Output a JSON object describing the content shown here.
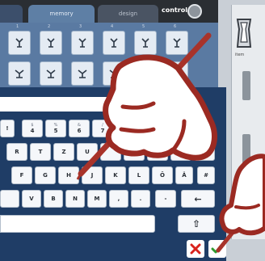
{
  "tabs": [
    {
      "label": ""
    },
    {
      "label": "memory"
    },
    {
      "label": "design"
    }
  ],
  "control_label": "control",
  "right_panel": {
    "caption": "item"
  },
  "row_numbers": [
    "1",
    "2",
    "3",
    "4",
    "5",
    "6"
  ],
  "keyboard": {
    "row1": [
      {
        "top": "",
        "main": "!"
      },
      {
        "top": "$",
        "main": "4"
      },
      {
        "top": "%",
        "main": "5"
      },
      {
        "top": "&",
        "main": "6"
      },
      {
        "top": "/",
        "main": "7"
      }
    ],
    "row2": [
      "R",
      "T",
      "Z",
      "U",
      "",
      "",
      "",
      "",
      ""
    ],
    "row2_right": "+",
    "row3": [
      "F",
      "G",
      "H",
      "J",
      "K",
      "L",
      "Ö",
      "Ä"
    ],
    "row3_right": "#",
    "row4": [
      "",
      "V",
      "B",
      "N",
      "M",
      ",",
      ".",
      "-"
    ],
    "backspace_glyph": "←",
    "shift_glyph": "⇧"
  },
  "colors": {
    "hand_outline": "#9b2a22",
    "pen": "#a8332a",
    "cancel": "#d9231d",
    "ok": "#2f9a2e"
  },
  "icons": {
    "cancel": "close-icon",
    "ok": "checkmark-icon",
    "control": "circle-button-icon",
    "stitch": "stitch-pattern-icon",
    "foot": "presser-foot-icon"
  }
}
